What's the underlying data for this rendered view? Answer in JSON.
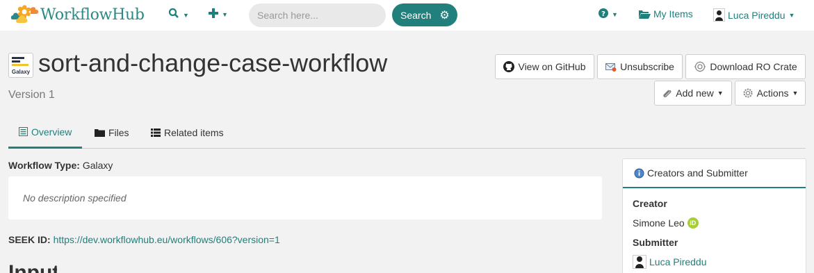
{
  "navbar": {
    "brand": "WorkflowHub",
    "search_placeholder": "Search here...",
    "search_button": "Search",
    "help_icon": "question-circle-icon",
    "my_items": "My Items",
    "user_name": "Luca Pireddu"
  },
  "header": {
    "title": "sort-and-change-case-workflow",
    "version": "Version 1",
    "logo_label": "Galaxy",
    "buttons": {
      "github": "View on GitHub",
      "unsubscribe": "Unsubscribe",
      "download": "Download RO Crate",
      "add_new": "Add new",
      "actions": "Actions"
    }
  },
  "tabs": [
    {
      "label": "Overview",
      "active": true,
      "icon": "list-alt-icon"
    },
    {
      "label": "Files",
      "active": false,
      "icon": "folder-icon"
    },
    {
      "label": "Related items",
      "active": false,
      "icon": "list-icon"
    }
  ],
  "main": {
    "workflow_type_label": "Workflow Type:",
    "workflow_type_value": "Galaxy",
    "description": "No description specified",
    "seek_id_label": "SEEK ID:",
    "seek_id_url": "https://dev.workflowhub.eu/workflows/606?version=1",
    "next_heading": "Inputs"
  },
  "side_panel": {
    "title": "Creators and Submitter",
    "creator_label": "Creator",
    "creator_name": "Simone Leo",
    "submitter_label": "Submitter",
    "submitter_name": "Luca Pireddu"
  },
  "colors": {
    "brand": "#22807c",
    "background": "#f2f2f2",
    "orcid": "#a6ce39"
  }
}
